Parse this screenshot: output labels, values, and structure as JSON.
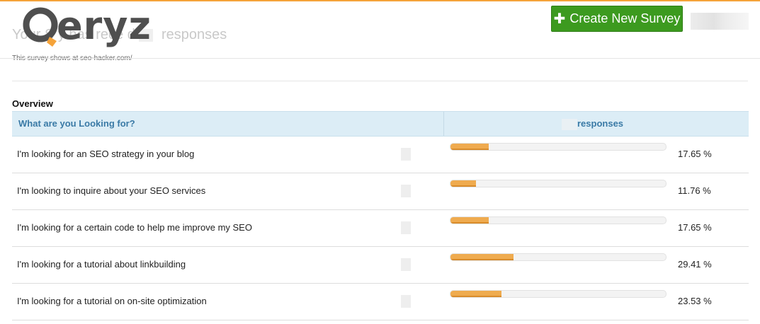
{
  "header": {
    "logo_text": "eryz",
    "faded_title_left": "Your S",
    "faded_title_mid": "y has rece",
    "faded_title_right": "d",
    "faded_title_responses": "responses",
    "subtitle": "This survey shows at seo-hacker.com/",
    "create_button_label": "Create New Survey",
    "create_button_icon": "plus-icon"
  },
  "overview": {
    "label": "Overview",
    "question_header": "What are you Looking for?",
    "responses_header": "responses",
    "rows": [
      {
        "label": "I'm looking for an SEO strategy in your blog",
        "percent": 17.65,
        "percent_text": "17.65 %"
      },
      {
        "label": "I'm looking to inquire about your SEO services",
        "percent": 11.76,
        "percent_text": "11.76 %"
      },
      {
        "label": "I'm looking for a certain code to help me improve my SEO",
        "percent": 17.65,
        "percent_text": "17.65 %"
      },
      {
        "label": "I'm looking for a tutorial about linkbuilding",
        "percent": 29.41,
        "percent_text": "29.41 %"
      },
      {
        "label": "I'm looking for a tutorial on on-site optimization",
        "percent": 23.53,
        "percent_text": "23.53 %"
      }
    ]
  },
  "colors": {
    "accent_top_border": "#f5a33a",
    "button_green": "#3c9a1f",
    "bar_fill": "#efab4f",
    "header_blue": "#3a7aa6",
    "header_bg": "#dcedf6"
  }
}
